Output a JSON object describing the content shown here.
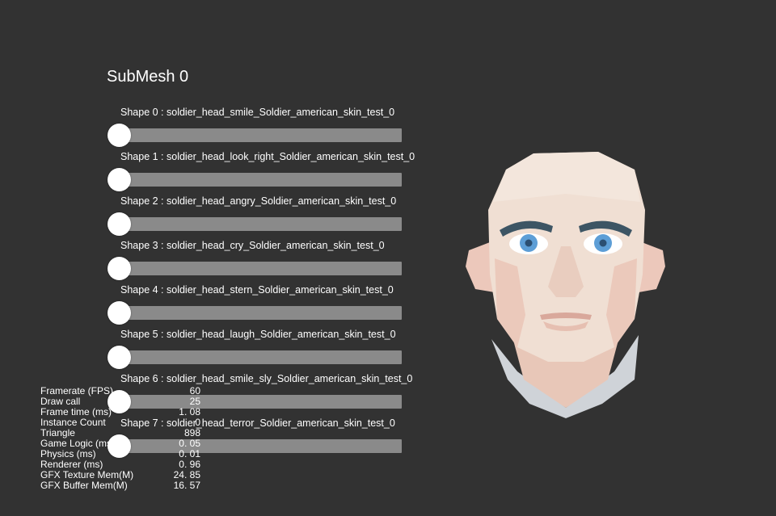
{
  "submesh": {
    "title": "SubMesh 0"
  },
  "shapes": [
    {
      "label": "Shape 0 : soldier_head_smile_Soldier_american_skin_test_0",
      "value": 0
    },
    {
      "label": "Shape 1 : soldier_head_look_right_Soldier_american_skin_test_0",
      "value": 0
    },
    {
      "label": "Shape 2 : soldier_head_angry_Soldier_american_skin_test_0",
      "value": 0
    },
    {
      "label": "Shape 3 : soldier_head_cry_Soldier_american_skin_test_0",
      "value": 0
    },
    {
      "label": "Shape 4 : soldier_head_stern_Soldier_american_skin_test_0",
      "value": 0
    },
    {
      "label": "Shape 5 : soldier_head_laugh_Soldier_american_skin_test_0",
      "value": 0
    },
    {
      "label": "Shape 6 : soldier_head_smile_sly_Soldier_american_skin_test_0",
      "value": 0
    },
    {
      "label": "Shape 7 : soldier_head_terror_Soldier_american_skin_test_0",
      "value": 0
    }
  ],
  "stats": [
    {
      "label": "Framerate (FPS)",
      "value": "60"
    },
    {
      "label": "Draw call",
      "value": "25"
    },
    {
      "label": "Frame time (ms)",
      "value": "1. 08"
    },
    {
      "label": "Instance Count",
      "value": "0"
    },
    {
      "label": "Triangle",
      "value": "898"
    },
    {
      "label": "Game Logic (ms)",
      "value": "0. 05"
    },
    {
      "label": "Physics (ms)",
      "value": "0. 01"
    },
    {
      "label": "Renderer (ms)",
      "value": "0. 96"
    },
    {
      "label": "GFX Texture Mem(M)",
      "value": "24. 85"
    },
    {
      "label": "GFX Buffer Mem(M)",
      "value": "16. 57"
    }
  ],
  "colors": {
    "background": "#323232",
    "track": "#8a8a8a",
    "thumb": "#ffffff",
    "skin": "#f0dfd3",
    "eyes": "#5d9ed6"
  }
}
